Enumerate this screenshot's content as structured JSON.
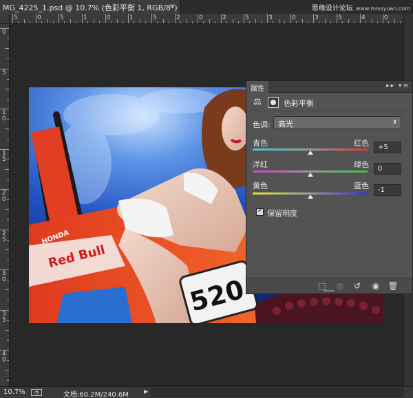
{
  "document_tab": {
    "title": "MG_4225_1.psd @ 10.7% (色彩平衡 1, RGB/8*) *",
    "close_glyph": "×"
  },
  "watermark": {
    "text": "思缘设计论坛",
    "url": "www.missyuan.com"
  },
  "rulers": {
    "top_labels": [
      "5",
      "0",
      "5",
      "1",
      "0",
      "1",
      "5",
      "2",
      "0",
      "2",
      "5",
      "3",
      "0",
      "3",
      "5",
      "4",
      "0"
    ],
    "left_labels": [
      "0",
      "5",
      "1 0",
      "1 5",
      "2 0",
      "2 5",
      "3 0",
      "3 5",
      "4 0"
    ]
  },
  "properties_panel": {
    "tab_label": "属性",
    "panel_controls": "▸▸ ▾≡",
    "title": "色彩平衡",
    "tone": {
      "label": "色调:",
      "selected": "高光",
      "arrow": "⬍"
    },
    "sliders": [
      {
        "left": "青色",
        "right": "红色",
        "value": "+5",
        "position": 0.5,
        "gradient": [
          "#2fd4d4",
          "#e03232"
        ]
      },
      {
        "left": "洋红",
        "right": "绿色",
        "value": "0",
        "position": 0.5,
        "gradient": [
          "#d43cd4",
          "#3cc83c"
        ]
      },
      {
        "left": "黄色",
        "right": "蓝色",
        "value": "-1",
        "position": 0.5,
        "gradient": [
          "#e6e632",
          "#3232e0"
        ]
      }
    ],
    "preserve_luminosity": {
      "label": "保留明度",
      "checked": true
    },
    "footer_icons": [
      "clip-to-layer-icon",
      "view-previous-icon",
      "reset-icon",
      "visibility-icon",
      "trash-icon"
    ]
  },
  "status_bar": {
    "zoom": "10.7%",
    "doc_info": "文档:60.2M/240.6M",
    "arrow": "▶"
  },
  "photo": {
    "number_plate": "520",
    "brand": "Red Bull",
    "maker": "HONDA"
  },
  "colors": {
    "panel_bg": "#535353",
    "workspace_bg": "#282828"
  }
}
